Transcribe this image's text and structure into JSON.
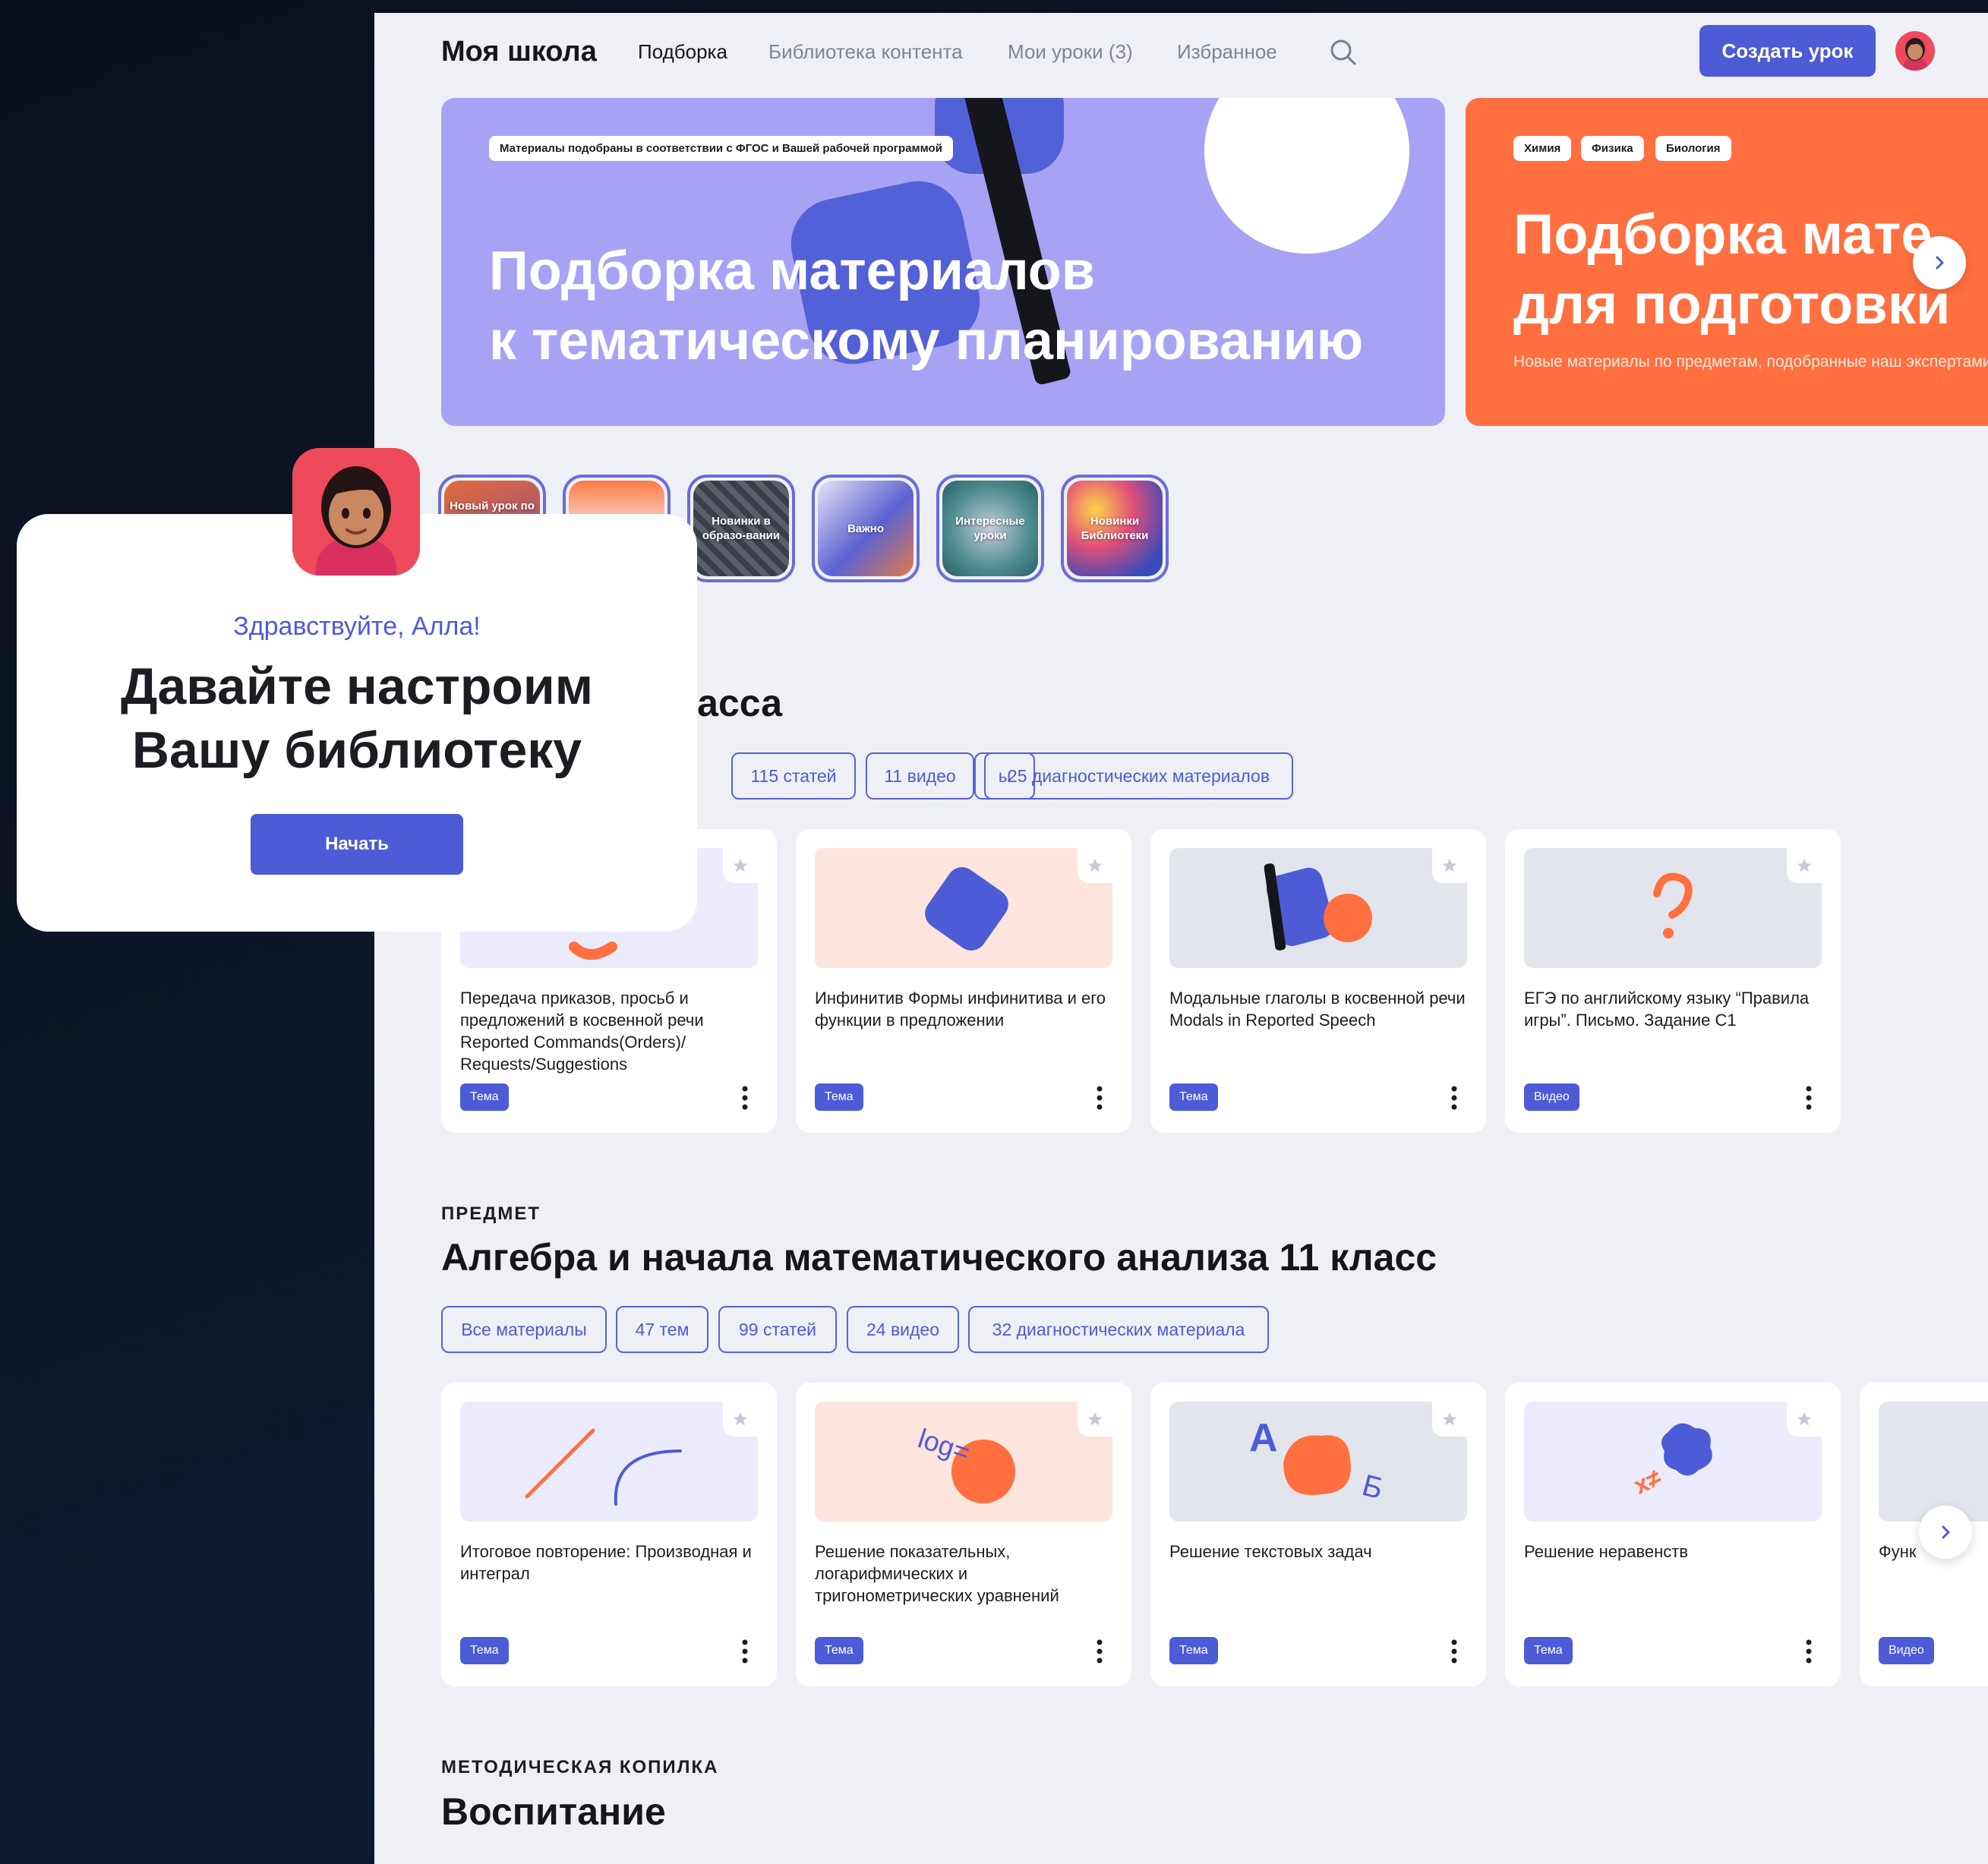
{
  "header": {
    "logo": "Моя школа",
    "nav": [
      "Подборка",
      "Библиотека контента",
      "Мои уроки (3)",
      "Избранное"
    ],
    "create_label": "Создать урок"
  },
  "banners": [
    {
      "chips": [
        "Материалы подобраны в соответствии с ФГОС и Вашей рабочей программой"
      ],
      "title_lines": [
        "Подборка материалов",
        "к тематическому планированию"
      ],
      "subtitle": ""
    },
    {
      "chips": [
        "Химия",
        "Физика",
        "Биология"
      ],
      "title_lines": [
        "Подборка мате",
        "для подготовки"
      ],
      "subtitle": "Новые материалы по предметам, подобранные наш экспертами"
    }
  ],
  "stories": [
    {
      "label": "Новый урок по"
    },
    {
      "label": ""
    },
    {
      "label": "Новинки в образо-вании"
    },
    {
      "label": "Важно"
    },
    {
      "label": "Интересные уроки"
    },
    {
      "label": "Новинки Библиотеки"
    }
  ],
  "section1": {
    "title": "зык для 11 класса",
    "chips": [
      "ы",
      "115 статей",
      "11 видео",
      "25 диагностических материалов"
    ],
    "cards": [
      {
        "text": "Передача приказов, просьб и предложений в косвенной речи Reported Commands(Orders)/ Requests/Suggestions",
        "badge": "Тема"
      },
      {
        "text": "Инфинитив Формы инфинитива и его функции в предложении",
        "badge": "Тема"
      },
      {
        "text": "Модальные глаголы в косвенной речи Modals in Reported Speech",
        "badge": "Тема"
      },
      {
        "text": "ЕГЭ по английскому языку “Правила игры”. Письмо. Задание С1",
        "badge": "Видео"
      }
    ]
  },
  "section2": {
    "tag": "ПРЕДМЕТ",
    "title": "Алгебра и начала математического анализа 11 класс",
    "chips": [
      "Все материалы",
      "47 тем",
      "99 статей",
      "24 видео",
      "32 диагностических материала"
    ],
    "cards": [
      {
        "text": "Итоговое повторение: Производная и интеграл",
        "badge": "Тема"
      },
      {
        "text": "Решение показательных, логарифмических и тригонометрических уравнений",
        "badge": "Тема"
      },
      {
        "text": "Решение текстовых задач",
        "badge": "Тема"
      },
      {
        "text": "Решение неравенств",
        "badge": "Тема"
      },
      {
        "text": "Функ",
        "badge": "Видео"
      }
    ],
    "thumb_text": {
      "log": "log=",
      "a": "A",
      "b": "Б",
      "x": "x≠"
    }
  },
  "section3": {
    "tag": "МЕТОДИЧЕСКАЯ КОПИЛКА",
    "title": "Воспитание"
  },
  "popup": {
    "greeting": "Здравствуйте, Алла!",
    "title_line1": "Давайте настроим",
    "title_line2": "Вашу библиотеку",
    "button": "Начать"
  },
  "colors": {
    "accent": "#4d5bd6",
    "banner_purple": "#a8a2f5",
    "banner_orange": "#ff6f3f",
    "page_bg": "#eef0f6",
    "dark_bg": "#0b1322"
  }
}
